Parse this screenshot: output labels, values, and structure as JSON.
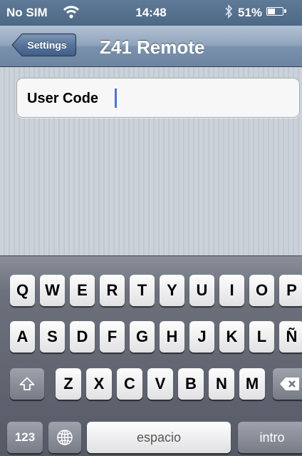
{
  "status_bar": {
    "carrier": "No SIM",
    "time": "14:48",
    "battery": "51%",
    "battery_level": 0.51
  },
  "nav": {
    "back_label": "Settings",
    "title": "Z41 Remote"
  },
  "form": {
    "user_code_label": "User Code",
    "user_code_value": ""
  },
  "keyboard": {
    "row1": [
      "Q",
      "W",
      "E",
      "R",
      "T",
      "Y",
      "U",
      "I",
      "O",
      "P"
    ],
    "row2": [
      "A",
      "S",
      "D",
      "F",
      "G",
      "H",
      "J",
      "K",
      "L",
      "Ñ"
    ],
    "row3": [
      "Z",
      "X",
      "C",
      "V",
      "B",
      "N",
      "M"
    ],
    "numbers_label": "123",
    "space_label": "espacio",
    "return_label": "intro"
  }
}
